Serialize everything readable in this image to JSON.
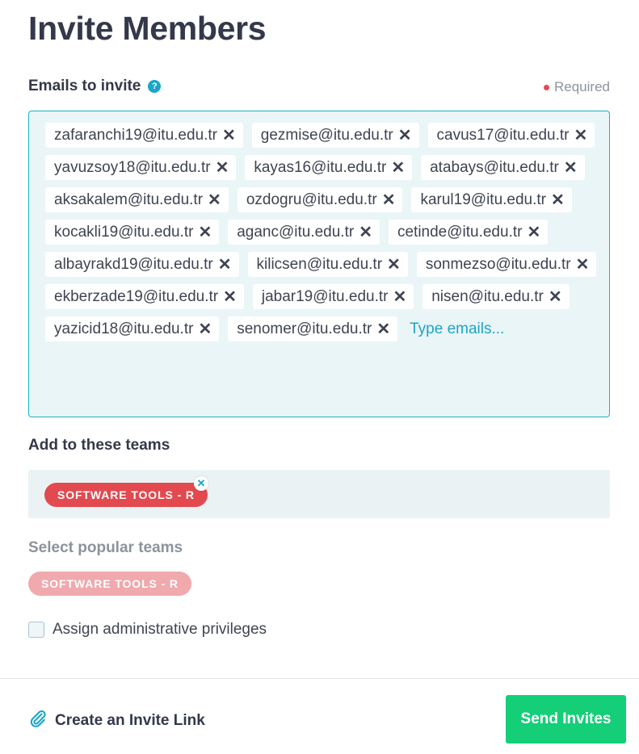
{
  "page": {
    "title": "Invite Members"
  },
  "emails": {
    "label": "Emails to invite",
    "help_icon": "?",
    "required_text": "Required",
    "chips": [
      "zafaranchi19@itu.edu.tr",
      "gezmise@itu.edu.tr",
      "cavus17@itu.edu.tr",
      "yavuzsoy18@itu.edu.tr",
      "kayas16@itu.edu.tr",
      "atabays@itu.edu.tr",
      "aksakalem@itu.edu.tr",
      "ozdogru@itu.edu.tr",
      "karul19@itu.edu.tr",
      "kocakli19@itu.edu.tr",
      "aganc@itu.edu.tr",
      "cetinde@itu.edu.tr",
      "albayrakd19@itu.edu.tr",
      "kilicsen@itu.edu.tr",
      "sonmezso@itu.edu.tr",
      "ekberzade19@itu.edu.tr",
      "jabar19@itu.edu.tr",
      "nisen@itu.edu.tr",
      "yazicid18@itu.edu.tr",
      "senomer@itu.edu.tr"
    ],
    "remove_symbol": "✕",
    "input_placeholder": "Type emails...",
    "input_value": ""
  },
  "teams": {
    "label": "Add to these teams",
    "selected": [
      "SOFTWARE TOOLS - R"
    ],
    "remove_symbol": "✕"
  },
  "popular": {
    "label": "Select popular teams",
    "items": [
      "SOFTWARE TOOLS - R"
    ]
  },
  "admin": {
    "label": "Assign administrative privileges",
    "checked": false
  },
  "footer": {
    "invite_link_label": "Create an Invite Link",
    "send_label": "Send Invites"
  },
  "colors": {
    "accent": "#1aa6c8",
    "required": "#e84a55",
    "team_chip": "#e24a50",
    "popular_chip": "#f0a9ac",
    "send_button": "#15cf78"
  },
  "icons": {
    "help": "question-circle-icon",
    "remove": "close-icon",
    "invite_link": "paperclip-icon"
  }
}
